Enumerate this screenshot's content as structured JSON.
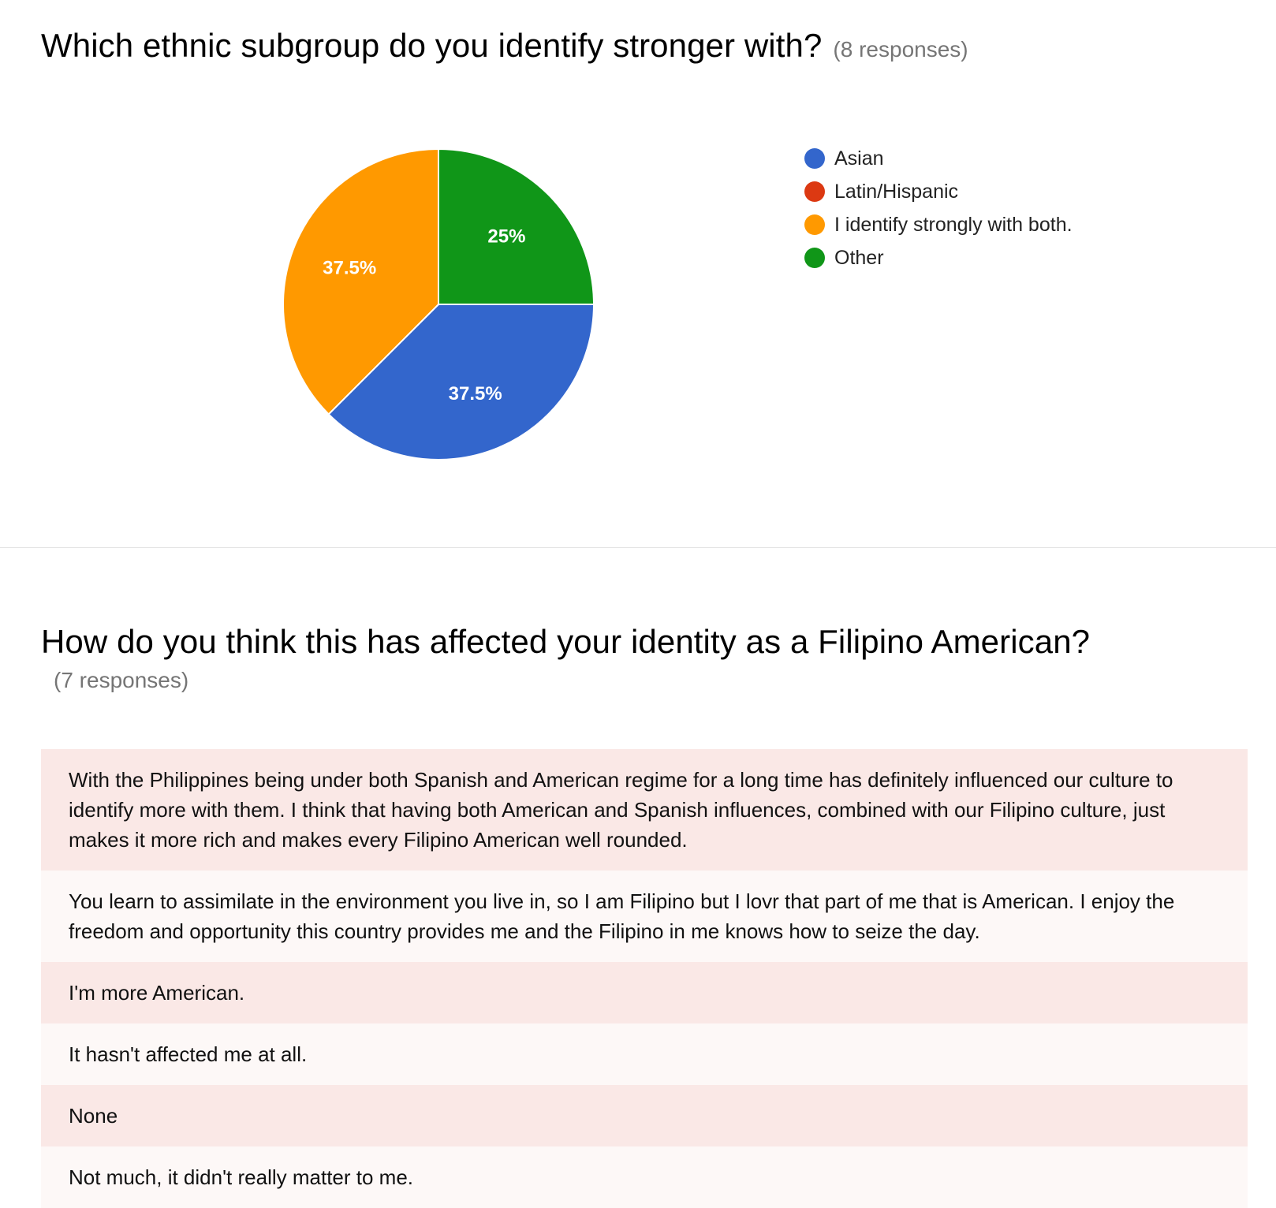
{
  "question1": {
    "title": "Which ethnic subgroup do you identify stronger with?",
    "response_count": "(8 responses)"
  },
  "chart_data": {
    "type": "pie",
    "categories": [
      "Asian",
      "Latin/Hispanic",
      "I identify strongly with both.",
      "Other"
    ],
    "values": [
      37.5,
      0,
      37.5,
      25
    ],
    "slice_labels": [
      "37.5%",
      "",
      "37.5%",
      "25%"
    ],
    "colors": [
      "#3366cc",
      "#dc3912",
      "#ff9900",
      "#109618"
    ],
    "legend_position": "right"
  },
  "question2": {
    "title": "How do you think this has affected your identity as a Filipino American?",
    "response_count": "(7 responses)",
    "responses": [
      "With the Philippines being under both Spanish and American regime for a long time has definitely influenced our culture to identify more with them. I think that having both American and Spanish influences, combined with our Filipino culture, just makes it more rich and makes every Filipino American well rounded.",
      "You learn to assimilate in the environment you live in, so I am Filipino but I lovr that part of me that is American. I enjoy the freedom and opportunity this country provides me and the Filipino in me knows how to seize the day.",
      "I'm more American.",
      "It hasn't affected me at all.",
      "None",
      "Not much, it didn't really matter to me."
    ]
  }
}
